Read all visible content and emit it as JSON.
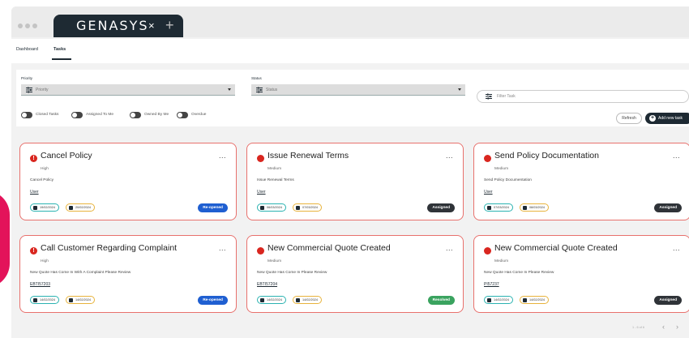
{
  "browser": {
    "app_name": "GENASYS",
    "tab_close": "×",
    "new_tab": "+"
  },
  "nav": {
    "tabs": [
      "Dashboard",
      "Tasks"
    ],
    "active_tab": "Tasks"
  },
  "filters": {
    "priority_label": "Priority",
    "priority_placeholder": "Priority",
    "status_label": "Status",
    "status_placeholder": "Status",
    "filter_placeholder": "Filter Task",
    "toggles": [
      "Closed Tasks",
      "Assigned To Me",
      "Owned By Me",
      "Overdue"
    ],
    "refresh_label": "Refresh",
    "add_label": "Add new task"
  },
  "colors": {
    "brand_dark": "#1e2a33",
    "card_border": "#e8716d",
    "priority_red": "#d9261f",
    "status_reopened": "#1f5fd1",
    "status_assigned": "#2f3338",
    "status_resolved": "#3aa35f",
    "chip_start": "#2bb3b1",
    "chip_due": "#e8b33c"
  },
  "cards": [
    {
      "icon": "priority-high-icon",
      "icon_glyph": "!",
      "title": "Cancel Policy",
      "more": "...",
      "priority": "High",
      "description": "Cancel Policy",
      "link": "User",
      "start_date": "19/02/2024",
      "due_date": "20/02/2024",
      "status": "Re-opened",
      "status_color": "#1f5fd1"
    },
    {
      "icon": "priority-medium-icon",
      "icon_glyph": "",
      "title": "Issue Renewal Terms",
      "more": "...",
      "priority": "Medium",
      "description": "Issue Renewal Terms",
      "link": "User",
      "start_date": "06/03/2024",
      "due_date": "07/03/2024",
      "status": "Assigned",
      "status_color": "#2f3338"
    },
    {
      "icon": "priority-medium-icon",
      "icon_glyph": "",
      "title": "Send Policy Documentation",
      "more": "...",
      "priority": "Medium",
      "description": "Send Policy Documentation",
      "link": "User",
      "start_date": "07/03/2024",
      "due_date": "08/03/2024",
      "status": "Assigned",
      "status_color": "#2f3338"
    },
    {
      "icon": "priority-high-icon",
      "icon_glyph": "!",
      "title": "Call Customer Regarding Complaint",
      "more": "...",
      "priority": "High",
      "description": "New Quote Has Come In With A Complaint Please Review",
      "link": "EBTI57203",
      "start_date": "14/02/2024",
      "due_date": "14/02/2024",
      "status": "Re-opened",
      "status_color": "#1f5fd1"
    },
    {
      "icon": "priority-medium-icon",
      "icon_glyph": "",
      "title": "New Commercial Quote Created",
      "more": "...",
      "priority": "Medium",
      "description": "New Quote Has Come In Please Review",
      "link": "EBTI57204",
      "start_date": "14/02/2024",
      "due_date": "14/02/2024",
      "status": "Resolved",
      "status_color": "#3aa35f"
    },
    {
      "icon": "priority-medium-icon",
      "icon_glyph": "",
      "title": "New Commercial Quote Created",
      "more": "...",
      "priority": "Medium",
      "description": "New Quote Has Come In Please Review",
      "link": "PI57237",
      "start_date": "14/02/2024",
      "due_date": "14/02/2024",
      "status": "Assigned",
      "status_color": "#2f3338"
    }
  ],
  "pagination": {
    "range": "1 - 6 of 6",
    "prev": "‹",
    "next": "›"
  }
}
